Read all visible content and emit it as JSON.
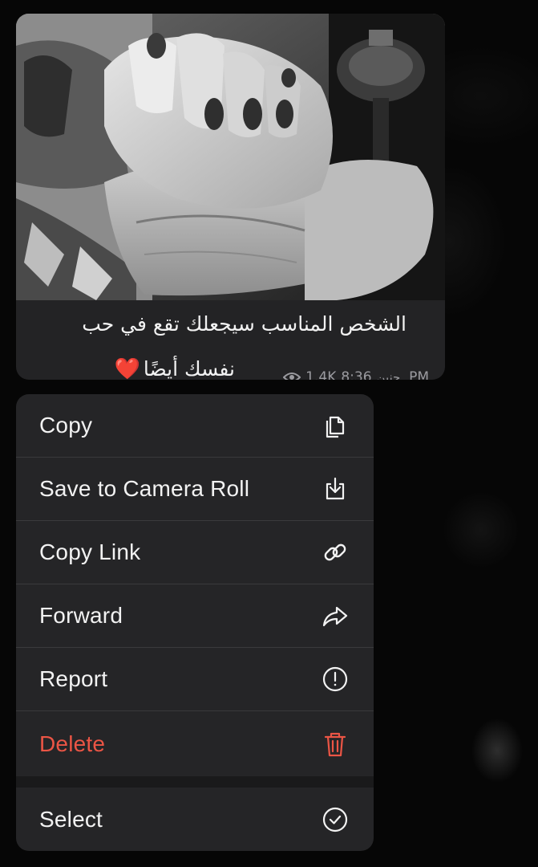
{
  "message": {
    "caption_line1": "الشخص المناسب سيجعلك تقع في حب",
    "caption_line2": "نفسك أيضًا",
    "heart": "❤️",
    "views": "1.4K",
    "time": "8:36",
    "author": "حنين,",
    "ampm": "PM"
  },
  "menu": {
    "items": [
      {
        "label": "Copy",
        "icon": "copy-icon"
      },
      {
        "label": "Save to Camera Roll",
        "icon": "save-download-icon"
      },
      {
        "label": "Copy Link",
        "icon": "link-icon"
      },
      {
        "label": "Forward",
        "icon": "forward-icon"
      },
      {
        "label": "Report",
        "icon": "report-exclamation-icon"
      },
      {
        "label": "Delete",
        "icon": "trash-icon"
      },
      {
        "label": "Select",
        "icon": "checkmark-circle-icon"
      }
    ]
  },
  "colors": {
    "menu_background": "#252527",
    "bubble_background": "#232325",
    "text": "#f2f2f2",
    "danger": "#eb5545",
    "meta": "#9b9ba0"
  }
}
